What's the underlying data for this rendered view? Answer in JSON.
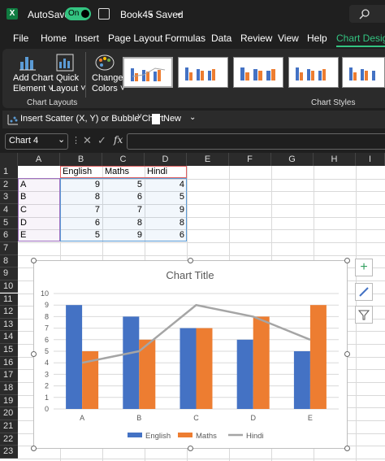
{
  "titlebar": {
    "autosave_label": "AutoSave",
    "autosave_state": "On",
    "filename": "Book45",
    "saved_status": "• Saved"
  },
  "tabs": [
    "File",
    "Home",
    "Insert",
    "Page Layout",
    "Formulas",
    "Data",
    "Review",
    "View",
    "Help",
    "Chart Design"
  ],
  "ribbon": {
    "add_chart_element_line1": "Add Chart",
    "add_chart_element_line2": "Element ˅",
    "quick_layout_line1": "Quick",
    "quick_layout_line2": "Layout ˅",
    "change_colors_line1": "Change",
    "change_colors_line2": "Colors ˅",
    "group_chart_layouts": "Chart Layouts",
    "group_chart_styles": "Chart Styles"
  },
  "toolbar2": {
    "insert_scatter": "Insert Scatter (X, Y) or Bubble Chart",
    "new_label": "New"
  },
  "formulabar": {
    "name_box": "Chart 4",
    "fx": "fx"
  },
  "columns": [
    "A",
    "B",
    "C",
    "D",
    "E",
    "F",
    "G",
    "H",
    "I"
  ],
  "rows": [
    "1",
    "2",
    "3",
    "4",
    "5",
    "6",
    "7",
    "8",
    "9",
    "10",
    "11",
    "12",
    "13",
    "14",
    "15",
    "16",
    "17",
    "18",
    "19",
    "20",
    "21",
    "22",
    "23"
  ],
  "table": {
    "headers": [
      "English",
      "Maths",
      "Hindi"
    ],
    "rows": [
      {
        "label": "A",
        "values": [
          "9",
          "5",
          "4"
        ]
      },
      {
        "label": "B",
        "values": [
          "8",
          "6",
          "5"
        ]
      },
      {
        "label": "C",
        "values": [
          "7",
          "7",
          "9"
        ]
      },
      {
        "label": "D",
        "values": [
          "6",
          "8",
          "8"
        ]
      },
      {
        "label": "E",
        "values": [
          "5",
          "9",
          "6"
        ]
      }
    ]
  },
  "chart_data": {
    "type": "bar",
    "title": "Chart Title",
    "categories": [
      "A",
      "B",
      "C",
      "D",
      "E"
    ],
    "series": [
      {
        "name": "English",
        "type": "bar",
        "values": [
          9,
          8,
          7,
          6,
          5
        ],
        "color": "#4472c4"
      },
      {
        "name": "Maths",
        "type": "bar",
        "values": [
          5,
          6,
          7,
          8,
          9
        ],
        "color": "#ed7d31"
      },
      {
        "name": "Hindi",
        "type": "line",
        "values": [
          4,
          5,
          9,
          8,
          6
        ],
        "color": "#a5a5a5"
      }
    ],
    "ylim": [
      0,
      10
    ],
    "yticks": [
      "0",
      "1",
      "2",
      "3",
      "4",
      "5",
      "6",
      "7",
      "8",
      "9",
      "10"
    ],
    "grid": true,
    "legend": "bottom"
  },
  "colors": {
    "accent_green": "#33c481",
    "excel_green": "#107c41"
  }
}
